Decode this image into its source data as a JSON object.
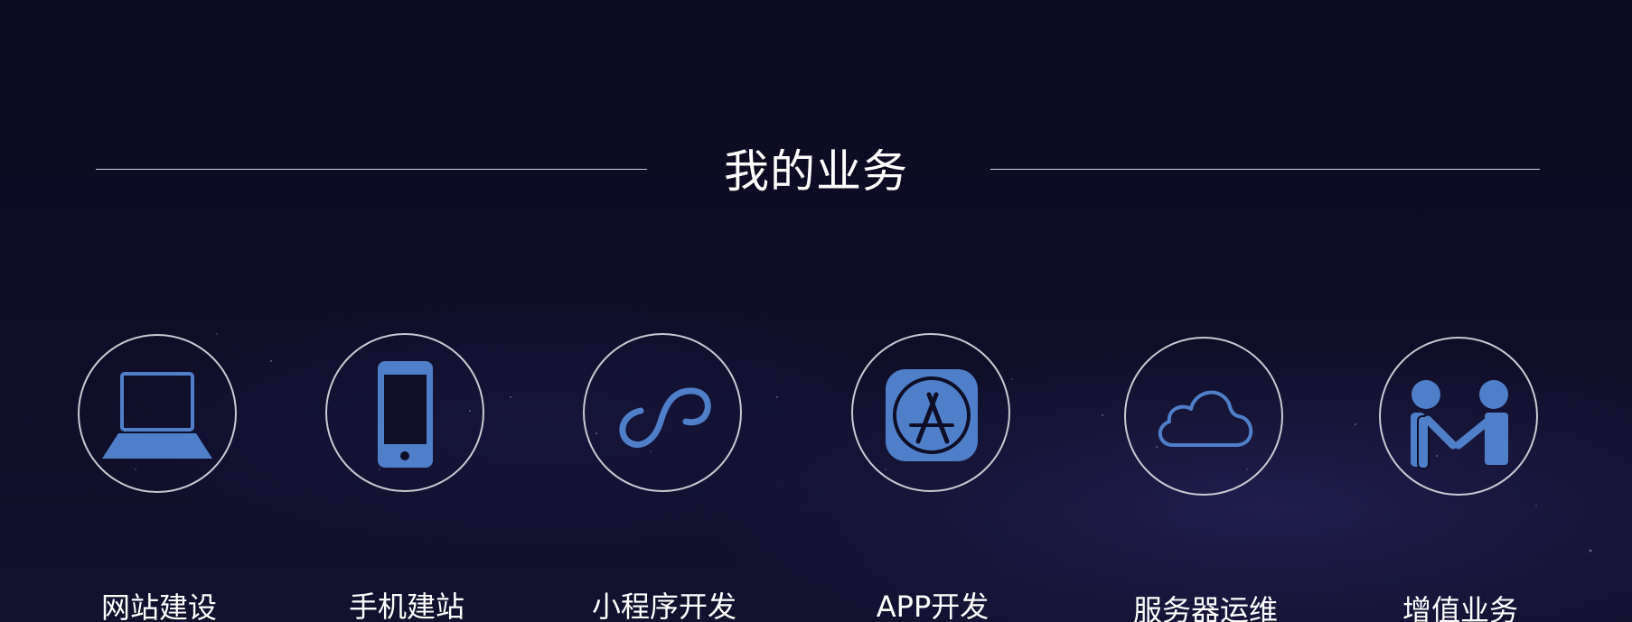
{
  "section": {
    "title": "我的业务"
  },
  "services": [
    {
      "label": "网站建设",
      "icon": "laptop-icon"
    },
    {
      "label": "手机建站",
      "icon": "smartphone-icon"
    },
    {
      "label": "小程序开发",
      "icon": "mini-program-icon"
    },
    {
      "label": "APP开发",
      "icon": "app-store-icon"
    },
    {
      "label": "服务器运维",
      "icon": "cloud-icon"
    },
    {
      "label": "增值业务",
      "icon": "handshake-icon"
    }
  ],
  "colors": {
    "background": "#0e0d26",
    "icon_blue": "#4f7fc9",
    "ring": "#c9c9d3",
    "text": "#ffffff"
  }
}
